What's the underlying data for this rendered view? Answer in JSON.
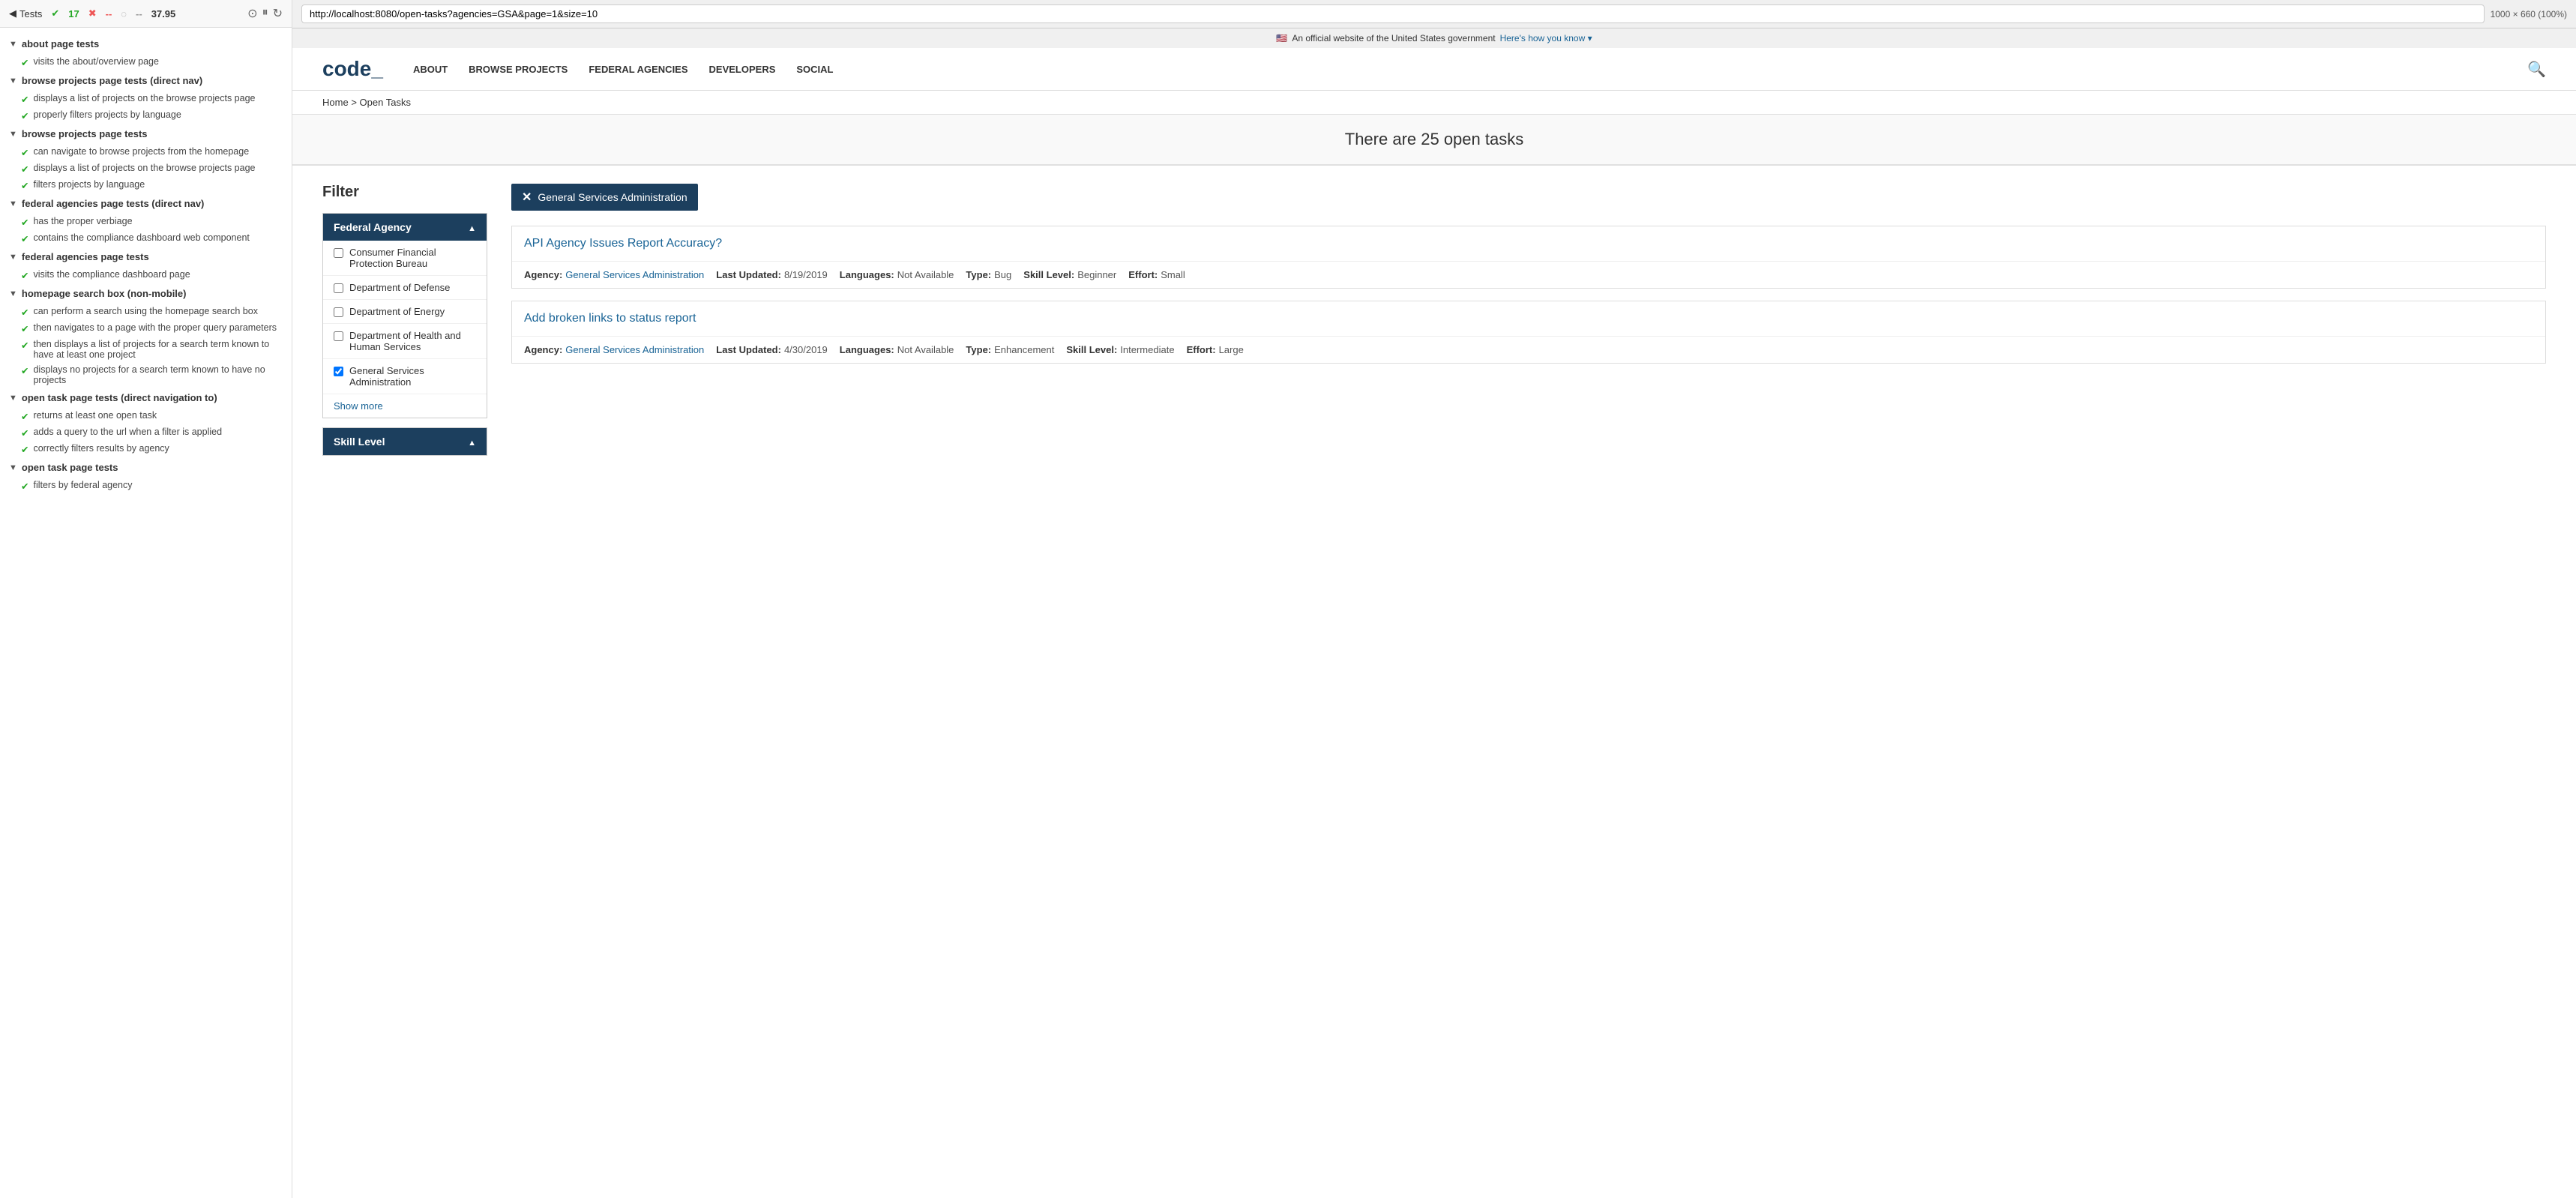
{
  "testPanel": {
    "backLabel": "Tests",
    "passCount": "17",
    "failCount": "--",
    "pendingCount": "--",
    "score": "37.95",
    "urlBar": "http://localhost:8080/open-tasks?agencies=GSA&page=1&size=10",
    "dimensions": "1000 × 660 (100%)",
    "groups": [
      {
        "id": "about-page",
        "label": "about page tests",
        "items": [
          {
            "text": "visits the about/overview page",
            "pass": true
          }
        ]
      },
      {
        "id": "browse-projects-direct",
        "label": "browse projects page tests (direct nav)",
        "items": [
          {
            "text": "displays a list of projects on the browse projects page",
            "pass": true
          },
          {
            "text": "properly filters projects by language",
            "pass": true
          }
        ]
      },
      {
        "id": "browse-projects",
        "label": "browse projects page tests",
        "items": [
          {
            "text": "can navigate to browse projects from the homepage",
            "pass": true
          },
          {
            "text": "displays a list of projects on the browse projects page",
            "pass": true
          },
          {
            "text": "filters projects by language",
            "pass": true
          }
        ]
      },
      {
        "id": "federal-agencies-direct",
        "label": "federal agencies page tests (direct nav)",
        "items": [
          {
            "text": "has the proper verbiage",
            "pass": true
          },
          {
            "text": "contains the compliance dashboard web component",
            "pass": true
          }
        ]
      },
      {
        "id": "federal-agencies",
        "label": "federal agencies page tests",
        "items": [
          {
            "text": "visits the compliance dashboard page",
            "pass": true
          }
        ]
      },
      {
        "id": "homepage-search",
        "label": "homepage search box (non-mobile)",
        "items": [
          {
            "text": "can perform a search using the homepage search box",
            "pass": true
          },
          {
            "text": "then navigates to a page with the proper query parameters",
            "pass": true
          },
          {
            "text": "then displays a list of projects for a search term known to have at least one project",
            "pass": true
          },
          {
            "text": "displays no projects for a search term known to have no projects",
            "pass": true
          }
        ]
      },
      {
        "id": "open-task-direct",
        "label": "open task page tests (direct navigation to)",
        "items": [
          {
            "text": "returns at least one open task",
            "pass": true
          },
          {
            "text": "adds a query to the url when a filter is applied",
            "pass": true
          },
          {
            "text": "correctly filters results by agency",
            "pass": true
          }
        ]
      },
      {
        "id": "open-task",
        "label": "open task page tests",
        "items": [
          {
            "text": "filters by federal agency",
            "pass": true
          }
        ]
      }
    ]
  },
  "govBanner": {
    "flag": "🇺🇸",
    "text": "An official website of the United States government",
    "linkText": "Here's how you know",
    "linkArrow": "▾"
  },
  "header": {
    "logoText": "code_",
    "navItems": [
      "ABOUT",
      "BROWSE PROJECTS",
      "FEDERAL AGENCIES",
      "DEVELOPERS",
      "SOCIAL"
    ]
  },
  "breadcrumb": {
    "homeLabel": "Home",
    "separator": ">",
    "currentPage": "Open Tasks"
  },
  "pageTitle": "There are 25 open tasks",
  "filter": {
    "title": "Filter",
    "sections": [
      {
        "id": "federal-agency",
        "label": "Federal Agency",
        "expanded": true,
        "options": [
          {
            "id": "cfpb",
            "label": "Consumer Financial Protection Bureau",
            "checked": false
          },
          {
            "id": "dod",
            "label": "Department of Defense",
            "checked": false
          },
          {
            "id": "doe",
            "label": "Department of Energy",
            "checked": false
          },
          {
            "id": "hhs",
            "label": "Department of Health and Human Services",
            "checked": false
          },
          {
            "id": "gsa",
            "label": "General Services Administration",
            "checked": true
          }
        ],
        "showMore": "Show more"
      },
      {
        "id": "skill-level",
        "label": "Skill Level",
        "expanded": true,
        "options": []
      }
    ]
  },
  "activeFilters": [
    {
      "id": "gsa-filter",
      "label": "General Services Administration",
      "removeLabel": "✕"
    }
  ],
  "tasks": [
    {
      "id": "task-1",
      "title": "API Agency Issues Report Accuracy?",
      "url": "#",
      "agencyLabel": "Agency:",
      "agencyName": "General Services Administration",
      "lastUpdatedLabel": "Last Updated:",
      "lastUpdated": "8/19/2019",
      "languagesLabel": "Languages:",
      "languages": "Not Available",
      "typeLabel": "Type:",
      "type": "Bug",
      "skillLevelLabel": "Skill Level:",
      "skillLevel": "Beginner",
      "effortLabel": "Effort:",
      "effort": "Small"
    },
    {
      "id": "task-2",
      "title": "Add broken links to status report",
      "url": "#",
      "agencyLabel": "Agency:",
      "agencyName": "General Services Administration",
      "lastUpdatedLabel": "Last Updated:",
      "lastUpdated": "4/30/2019",
      "languagesLabel": "Languages:",
      "languages": "Not Available",
      "typeLabel": "Type:",
      "type": "Enhancement",
      "skillLevelLabel": "Skill Level:",
      "skillLevel": "Intermediate",
      "effortLabel": "Effort:",
      "effort": "Large"
    }
  ]
}
